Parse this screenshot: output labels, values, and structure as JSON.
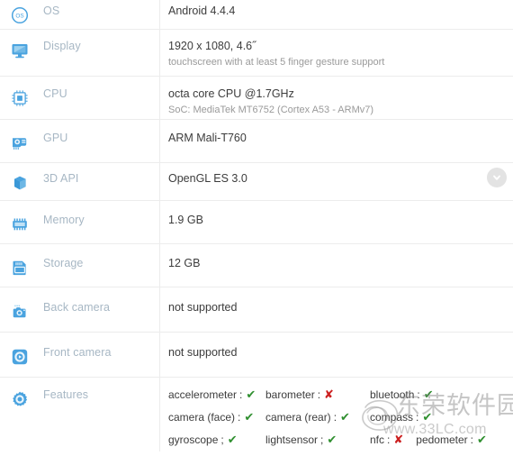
{
  "table": {
    "rows": [
      {
        "icon": "os-icon",
        "label": "OS",
        "value": "Android 4.4.4",
        "sub": ""
      },
      {
        "icon": "display-monitor-icon",
        "label": "Display",
        "value": "1920 x 1080, 4.6˝",
        "sub": "touchscreen with at least 5 finger gesture support"
      },
      {
        "icon": "cpu-chip-icon",
        "label": "CPU",
        "value": "octa core CPU @1.7GHz",
        "sub": "SoC: MediaTek MT6752 (Cortex A53 - ARMv7)"
      },
      {
        "icon": "gpu-card-icon",
        "label": "GPU",
        "value": "ARM Mali-T760",
        "sub": ""
      },
      {
        "icon": "cube-3d-icon",
        "label": "3D API",
        "value": "OpenGL ES 3.0",
        "sub": ""
      },
      {
        "icon": "memory-ram-icon",
        "label": "Memory",
        "value": "1.9 GB",
        "sub": ""
      },
      {
        "icon": "storage-card-icon",
        "label": "Storage",
        "value": "12 GB",
        "sub": ""
      },
      {
        "icon": "back-camera-icon",
        "label": "Back camera",
        "value": "not supported",
        "sub": ""
      },
      {
        "icon": "front-camera-icon",
        "label": "Front camera",
        "value": "not supported",
        "sub": ""
      }
    ],
    "features_row": {
      "icon": "features-gear-icon",
      "label": "Features"
    }
  },
  "features": {
    "separator": ":",
    "mark_yes": "✔",
    "mark_no": "✘",
    "lines": [
      [
        {
          "name": "accelerometer",
          "sep": ":",
          "supported": true
        },
        {
          "name": "barometer",
          "sep": ":",
          "supported": false
        },
        {
          "name": "bluetooth",
          "sep": ":",
          "supported": true
        }
      ],
      [
        {
          "name": "camera (face)",
          "sep": ":",
          "supported": true
        },
        {
          "name": "camera (rear)",
          "sep": ":",
          "supported": true
        },
        {
          "name": "compass",
          "sep": ":",
          "supported": true
        }
      ],
      [
        {
          "name": "gyroscope",
          "sep": ";",
          "supported": true
        },
        {
          "name": "lightsensor",
          "sep": ";",
          "supported": true
        },
        {
          "name": "nfc",
          "sep": ":",
          "supported": false
        },
        {
          "name": "pedometer",
          "sep": ":",
          "supported": true
        }
      ]
    ]
  },
  "scroll_down": {
    "icon": "chevron-down-icon"
  },
  "watermark": {
    "text_cn": "东荣软件园",
    "text_url": "www.33LC.com",
    "icon": "watermark-swirl-icon"
  },
  "colors": {
    "label": "#a7b7c4",
    "value": "#3c3c3c",
    "subvalue": "#9a9a9a",
    "icon_blue": "#4aa3df",
    "divider": "#ececec",
    "yes_green": "#2f8f2f",
    "no_red": "#cc2020",
    "scroll_btn_bg": "#e3e3e3"
  }
}
